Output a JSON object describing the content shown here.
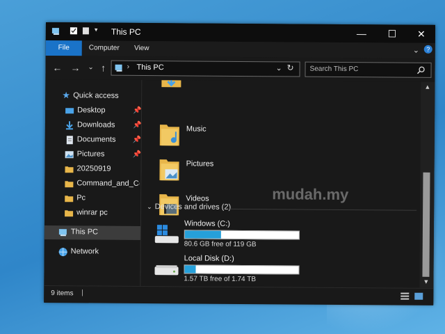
{
  "window": {
    "title": "This PC",
    "minimize_glyph": "—",
    "maximize_glyph": "☐",
    "close_glyph": "✕"
  },
  "ribbon": {
    "tabs": [
      {
        "label": "File"
      },
      {
        "label": "Computer"
      },
      {
        "label": "View"
      }
    ]
  },
  "address": {
    "path": "This PC",
    "separator": "›",
    "search_placeholder": "Search This PC"
  },
  "sidebar": {
    "items": [
      {
        "label": "Quick access",
        "icon": "star-icon"
      },
      {
        "label": "Desktop",
        "icon": "desktop-icon",
        "pinned": true
      },
      {
        "label": "Downloads",
        "icon": "download-icon",
        "pinned": true
      },
      {
        "label": "Documents",
        "icon": "documents-icon",
        "pinned": true
      },
      {
        "label": "Pictures",
        "icon": "pictures-icon",
        "pinned": true
      },
      {
        "label": "20250919",
        "icon": "folder-icon"
      },
      {
        "label": "Command_and_Con",
        "icon": "folder-icon"
      },
      {
        "label": "Pc",
        "icon": "folder-icon"
      },
      {
        "label": "winrar pc",
        "icon": "folder-icon"
      },
      {
        "label": "This PC",
        "icon": "computer-icon",
        "selected": true
      },
      {
        "label": "Network",
        "icon": "network-icon"
      }
    ]
  },
  "content": {
    "folders": [
      {
        "label": "Music"
      },
      {
        "label": "Pictures"
      },
      {
        "label": "Videos"
      }
    ],
    "devices_header": "Devices and drives (2)",
    "drives": [
      {
        "name": "Windows (C:)",
        "free_text": "80.6 GB free of 119 GB",
        "used_fraction": 0.32
      },
      {
        "name": "Local Disk (D:)",
        "free_text": "1.57 TB free of 1.74 TB",
        "used_fraction": 0.1
      }
    ]
  },
  "status": {
    "items_text": "9 items"
  },
  "watermark": "mudah.my",
  "colors": {
    "accent": "#1a73c8",
    "drive_fill": "#26a0da",
    "folder": "#e8b64a"
  }
}
